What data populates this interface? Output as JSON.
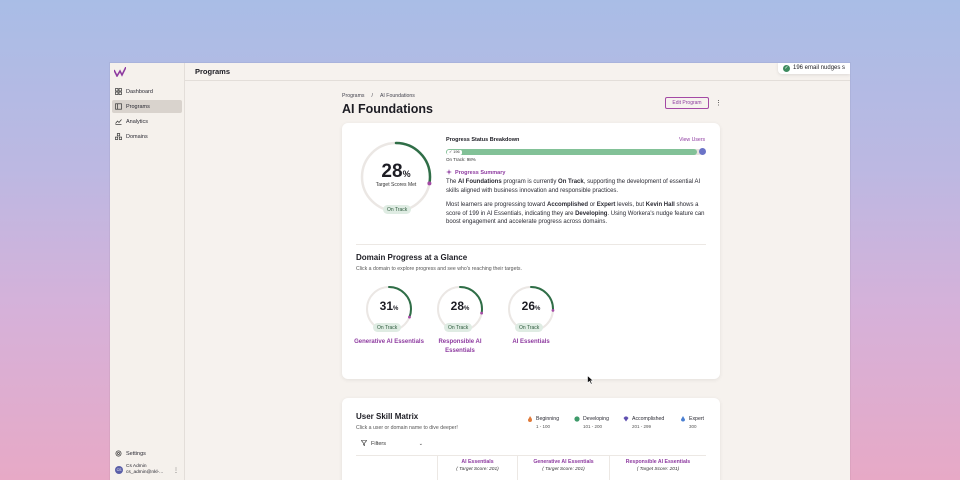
{
  "topbar": {
    "title": "Programs"
  },
  "toast": {
    "text": "196 email nudges s"
  },
  "sidebar": {
    "items": [
      {
        "label": "Dashboard",
        "icon": "dashboard-icon",
        "active": false
      },
      {
        "label": "Programs",
        "icon": "programs-icon",
        "active": true
      },
      {
        "label": "Analytics",
        "icon": "analytics-icon",
        "active": false
      },
      {
        "label": "Domains",
        "icon": "domains-icon",
        "active": false
      }
    ],
    "settings": "Settings",
    "user": {
      "initials": "CS",
      "name": "Cs Admin",
      "email": "cs_admin@nkl-..."
    }
  },
  "breadcrumb": {
    "parent": "Programs",
    "sep": "/",
    "current": "AI Foundations"
  },
  "page": {
    "title": "AI Foundations",
    "edit_label": "Edit Program"
  },
  "summary_card": {
    "gauge": {
      "percent": 28,
      "value": "28",
      "unit": "%",
      "label": "Target Scores Met",
      "status": "On Track"
    },
    "breakdown_title": "Progress Status Breakdown",
    "view_users": "View Users",
    "bar": {
      "fill_percent": 98,
      "tag": "196",
      "caption": "On Track: 98%"
    },
    "summary_title": "Progress Summary",
    "para1": {
      "t1": "The ",
      "b1": "AI Foundations",
      "t2": " program is currently ",
      "b2": "On Track",
      "t3": ", supporting the development of essential AI skills aligned with business innovation and responsible practices."
    },
    "para2": {
      "t1": "Most learners are progressing toward ",
      "b1": "Accomplished",
      "t2": " or ",
      "b2": "Expert",
      "t3": " levels, but ",
      "b3": "Kevin Hall",
      "t4": " shows a score of 199 in AI Essentials, indicating they are ",
      "b4": "Developing",
      "t5": ". Using Workera's nudge feature can boost engagement and accelerate progress across domains."
    },
    "domain_title": "Domain Progress at a Glance",
    "domain_sub": "Click a domain to explore progress and see who's reaching their targets.",
    "domains": [
      {
        "value": "31",
        "unit": "%",
        "percent": 31,
        "status": "On Track",
        "name": "Generative AI Essentials"
      },
      {
        "value": "28",
        "unit": "%",
        "percent": 28,
        "status": "On Track",
        "name": "Responsible AI Essentials"
      },
      {
        "value": "26",
        "unit": "%",
        "percent": 26,
        "status": "On Track",
        "name": "AI Essentials"
      }
    ]
  },
  "matrix": {
    "title": "User Skill Matrix",
    "sub": "Click a user or domain name to dive deeper!",
    "filters": "Filters",
    "legend": [
      {
        "label": "Beginning",
        "range": "1 - 100",
        "color": "#e07a3a"
      },
      {
        "label": "Developing",
        "range": "101 - 200",
        "color": "#3e9a6a"
      },
      {
        "label": "Accomplished",
        "range": "201 - 299",
        "color": "#5f4fb0"
      },
      {
        "label": "Expert",
        "range": "300",
        "color": "#4a7fd1"
      }
    ],
    "columns": [
      {
        "name": "AI Essentials",
        "target": "( Target Score: 201)"
      },
      {
        "name": "Generative AI Essentials",
        "target": "( Target Score: 201)"
      },
      {
        "name": "Responsible AI Essentials",
        "target": "( Target Score: 201)"
      }
    ]
  },
  "colors": {
    "accent": "#8e3ba0",
    "track_green": "#2f6e47",
    "bar_green": "#82c197"
  }
}
